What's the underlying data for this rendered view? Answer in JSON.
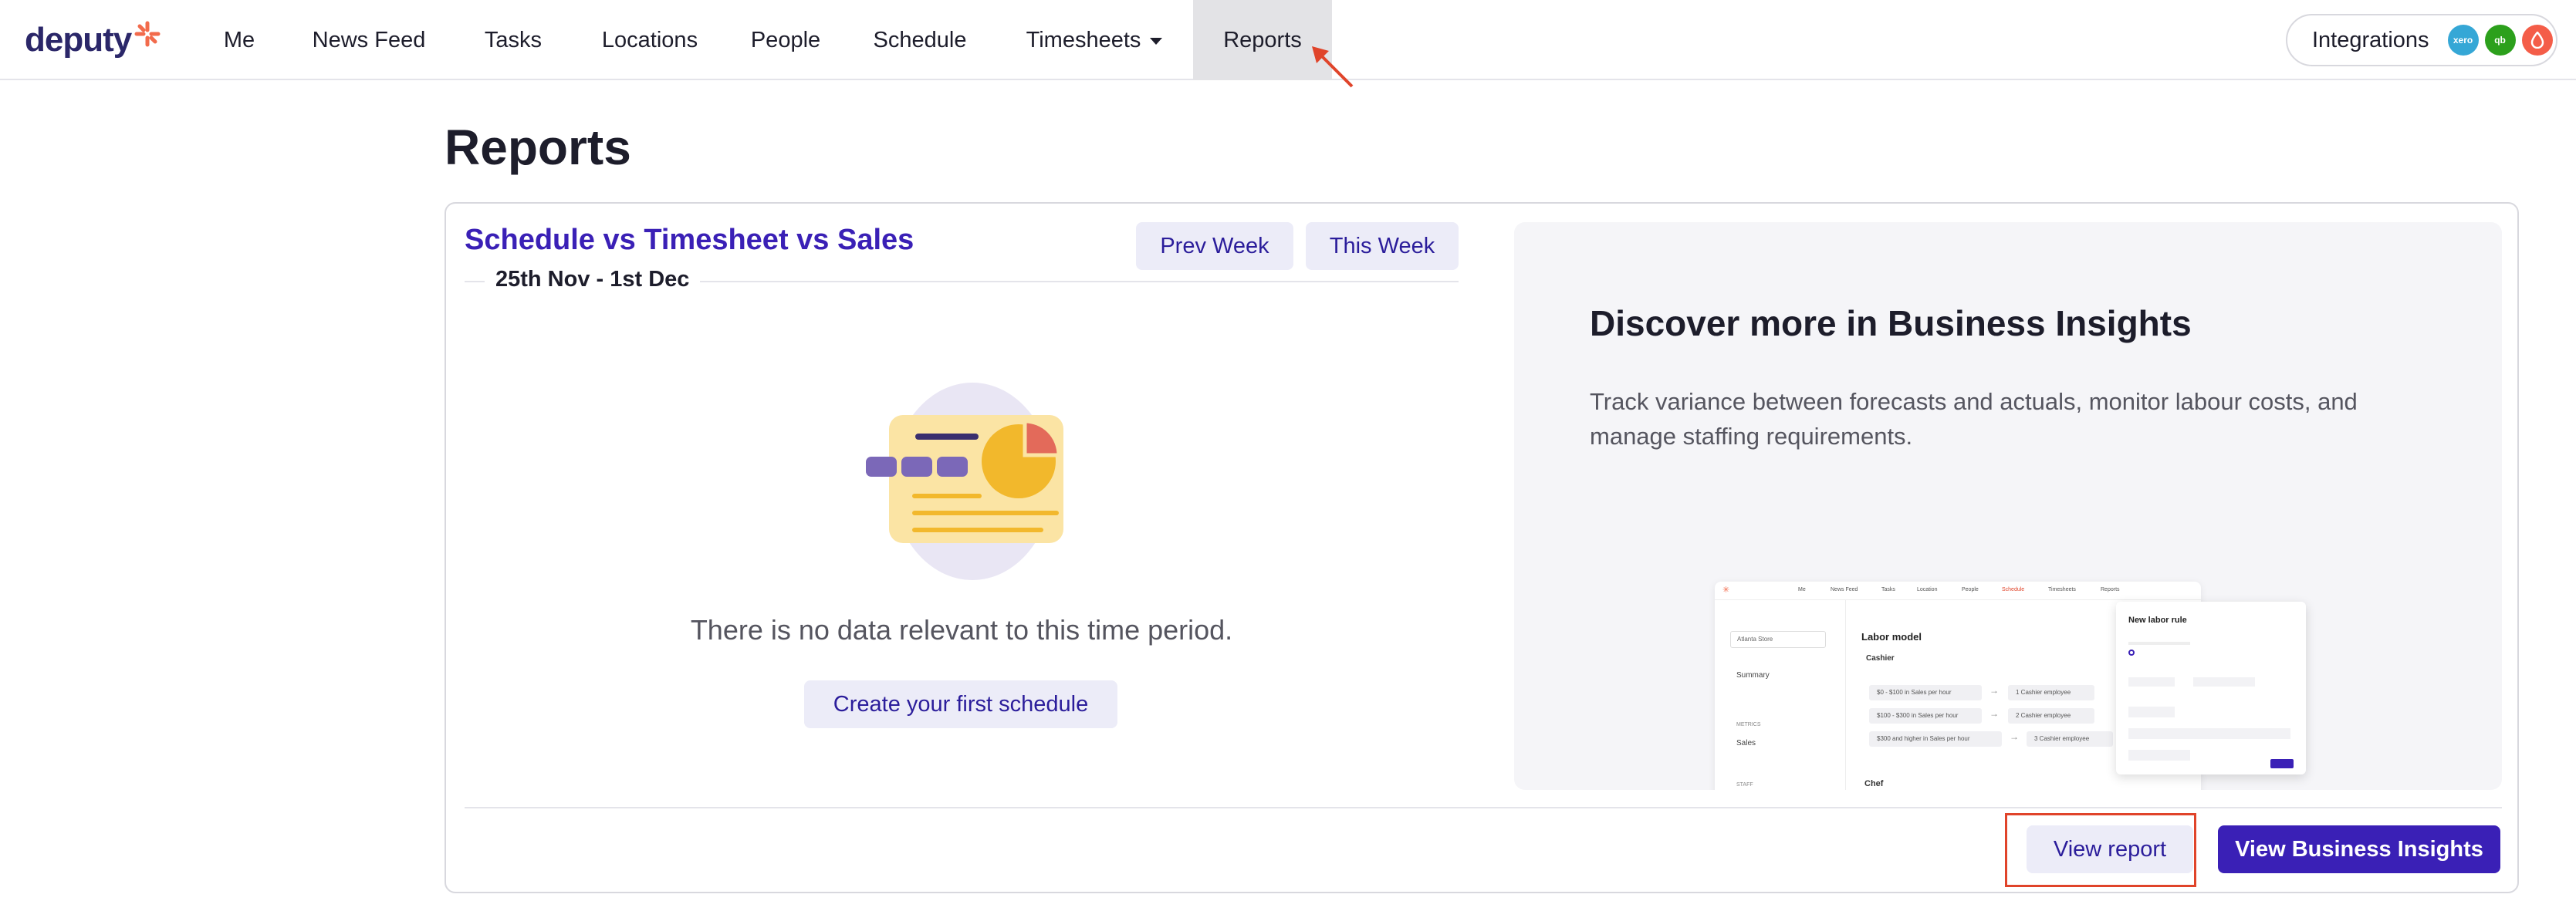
{
  "brand": {
    "name": "deputy"
  },
  "nav": {
    "items": [
      {
        "label": "Me"
      },
      {
        "label": "News Feed"
      },
      {
        "label": "Tasks"
      },
      {
        "label": "Locations"
      },
      {
        "label": "People"
      },
      {
        "label": "Schedule"
      },
      {
        "label": "Timesheets"
      },
      {
        "label": "Reports"
      }
    ],
    "active": "Reports",
    "integrations_label": "Integrations",
    "integration_icons": [
      "xero-icon",
      "quickbooks-icon",
      "gusto-icon"
    ]
  },
  "page": {
    "title": "Reports"
  },
  "report": {
    "title": "Schedule vs Timesheet vs Sales",
    "prev_week_label": "Prev Week",
    "this_week_label": "This Week",
    "date_range": "25th Nov - 1st Dec",
    "empty_message": "There is no data relevant to this time period.",
    "create_label": "Create your first schedule",
    "view_report_label": "View report"
  },
  "insights": {
    "title": "Discover more in Business Insights",
    "description": "Track variance between forecasts and actuals, monitor labour costs, and manage staffing requirements.",
    "button_label": "View Business Insights",
    "preview": {
      "nav": [
        "Me",
        "News Feed",
        "Tasks",
        "Location",
        "People",
        "Schedule",
        "Timesheets",
        "Reports"
      ],
      "store": "Atlanta Store",
      "side_summary": "Summary",
      "side_metrics": "METRICS",
      "side_sales": "Sales",
      "side_staff": "STAFF",
      "heading": "Labor model",
      "role": "Cashier",
      "rules": [
        {
          "condition": "$0 - $100 in Sales per hour",
          "result": "1 Cashier employee"
        },
        {
          "condition": "$100 - $300 in Sales per hour",
          "result": "2 Cashier employee"
        },
        {
          "condition": "$300 and higher in Sales per hour",
          "result": "3 Cashier employee"
        }
      ],
      "role2": "Chef",
      "modal_title": "New labor rule"
    }
  },
  "colors": {
    "brand": "#2b2769",
    "accent": "#3a20b6",
    "logo_star": "#f26b4c",
    "highlight": "#e0442a"
  }
}
